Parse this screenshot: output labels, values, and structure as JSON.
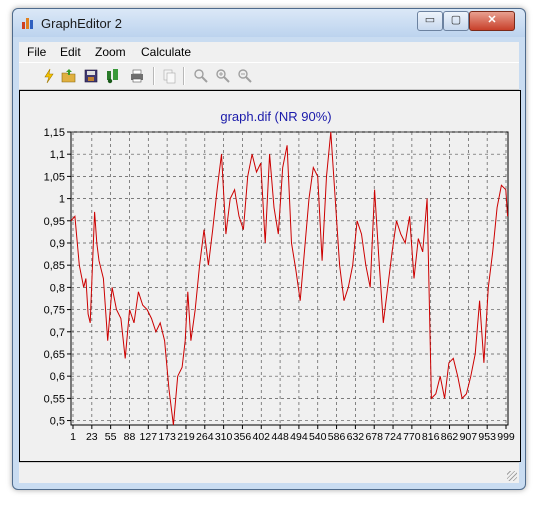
{
  "window": {
    "title": "GraphEditor 2",
    "min_glyph": "▭",
    "max_glyph": "▢",
    "close_glyph": "✕"
  },
  "menu": {
    "items": [
      "File",
      "Edit",
      "Zoom",
      "Calculate"
    ]
  },
  "toolbar": {
    "icons": [
      "new-lightning-icon",
      "open-folder-icon",
      "save-icon",
      "plot-icon",
      "print-icon",
      "copy-icon",
      "zoom-icon",
      "zoom-in-icon",
      "zoom-out-icon"
    ]
  },
  "chart_data": {
    "type": "line",
    "title": "graph.dif (NR 90%)",
    "xlabel": "",
    "ylabel": "",
    "ylim": [
      0.49,
      1.15
    ],
    "xlim": [
      1,
      1000
    ],
    "y_ticks": [
      "1,15",
      "1,1",
      "1,05",
      "1",
      "0,95",
      "0,9",
      "0,85",
      "0,8",
      "0,75",
      "0,7",
      "0,65",
      "0,6",
      "0,55",
      "0,5"
    ],
    "x_ticks": [
      "1",
      "23",
      "55",
      "88",
      "127",
      "173",
      "219",
      "264",
      "310",
      "356",
      "402",
      "448",
      "494",
      "540",
      "586",
      "632",
      "678",
      "724",
      "770",
      "816",
      "862",
      "907",
      "953",
      "999"
    ],
    "grid": true,
    "line_color": "#cc0000",
    "series": [
      {
        "x": [
          1,
          10,
          20,
          30,
          35,
          40,
          45,
          55,
          60,
          65,
          75,
          85,
          95,
          105,
          115,
          125,
          135,
          145,
          155,
          165,
          175,
          185,
          195,
          205,
          215,
          225,
          235,
          245,
          255,
          262,
          268,
          275,
          285,
          295,
          305,
          315,
          325,
          335,
          345,
          355,
          365,
          375,
          385,
          395,
          405,
          415,
          425,
          435,
          445,
          455,
          465,
          475,
          485,
          495,
          505,
          515,
          525,
          545,
          555,
          565,
          575,
          585,
          595,
          605,
          615,
          625,
          635,
          645,
          655,
          665,
          675,
          685,
          695,
          705,
          715,
          725,
          735,
          745,
          755,
          765,
          775,
          785,
          795,
          805,
          815,
          825,
          835,
          845,
          855,
          865,
          875,
          885,
          895,
          905,
          915,
          925,
          935,
          945,
          955,
          965,
          975,
          985,
          995,
          999
        ],
        "y": [
          0.95,
          0.96,
          0.85,
          0.8,
          0.82,
          0.74,
          0.72,
          0.97,
          0.9,
          0.86,
          0.82,
          0.68,
          0.8,
          0.75,
          0.73,
          0.64,
          0.75,
          0.72,
          0.79,
          0.76,
          0.75,
          0.73,
          0.7,
          0.72,
          0.68,
          0.57,
          0.49,
          0.6,
          0.62,
          0.68,
          0.79,
          0.68,
          0.75,
          0.85,
          0.93,
          0.85,
          0.93,
          1.02,
          1.1,
          0.92,
          1.0,
          1.02,
          0.96,
          0.93,
          1.05,
          1.1,
          1.06,
          1.08,
          0.9,
          1.1,
          0.98,
          0.92,
          1.07,
          1.12,
          0.9,
          0.84,
          0.77,
          1.0,
          1.07,
          1.05,
          0.86,
          1.05,
          1.15,
          1.0,
          0.85,
          0.77,
          0.8,
          0.85,
          0.95,
          0.92,
          0.85,
          0.8,
          1.02,
          0.86,
          0.72,
          0.8,
          0.88,
          0.95,
          0.92,
          0.9,
          0.96,
          0.82,
          0.91,
          0.88,
          1.0,
          0.55,
          0.56,
          0.6,
          0.55,
          0.63,
          0.64,
          0.6,
          0.55,
          0.56,
          0.6,
          0.65,
          0.77,
          0.63,
          0.8,
          0.88,
          0.98,
          1.03,
          1.02,
          0.96
        ]
      }
    ]
  }
}
